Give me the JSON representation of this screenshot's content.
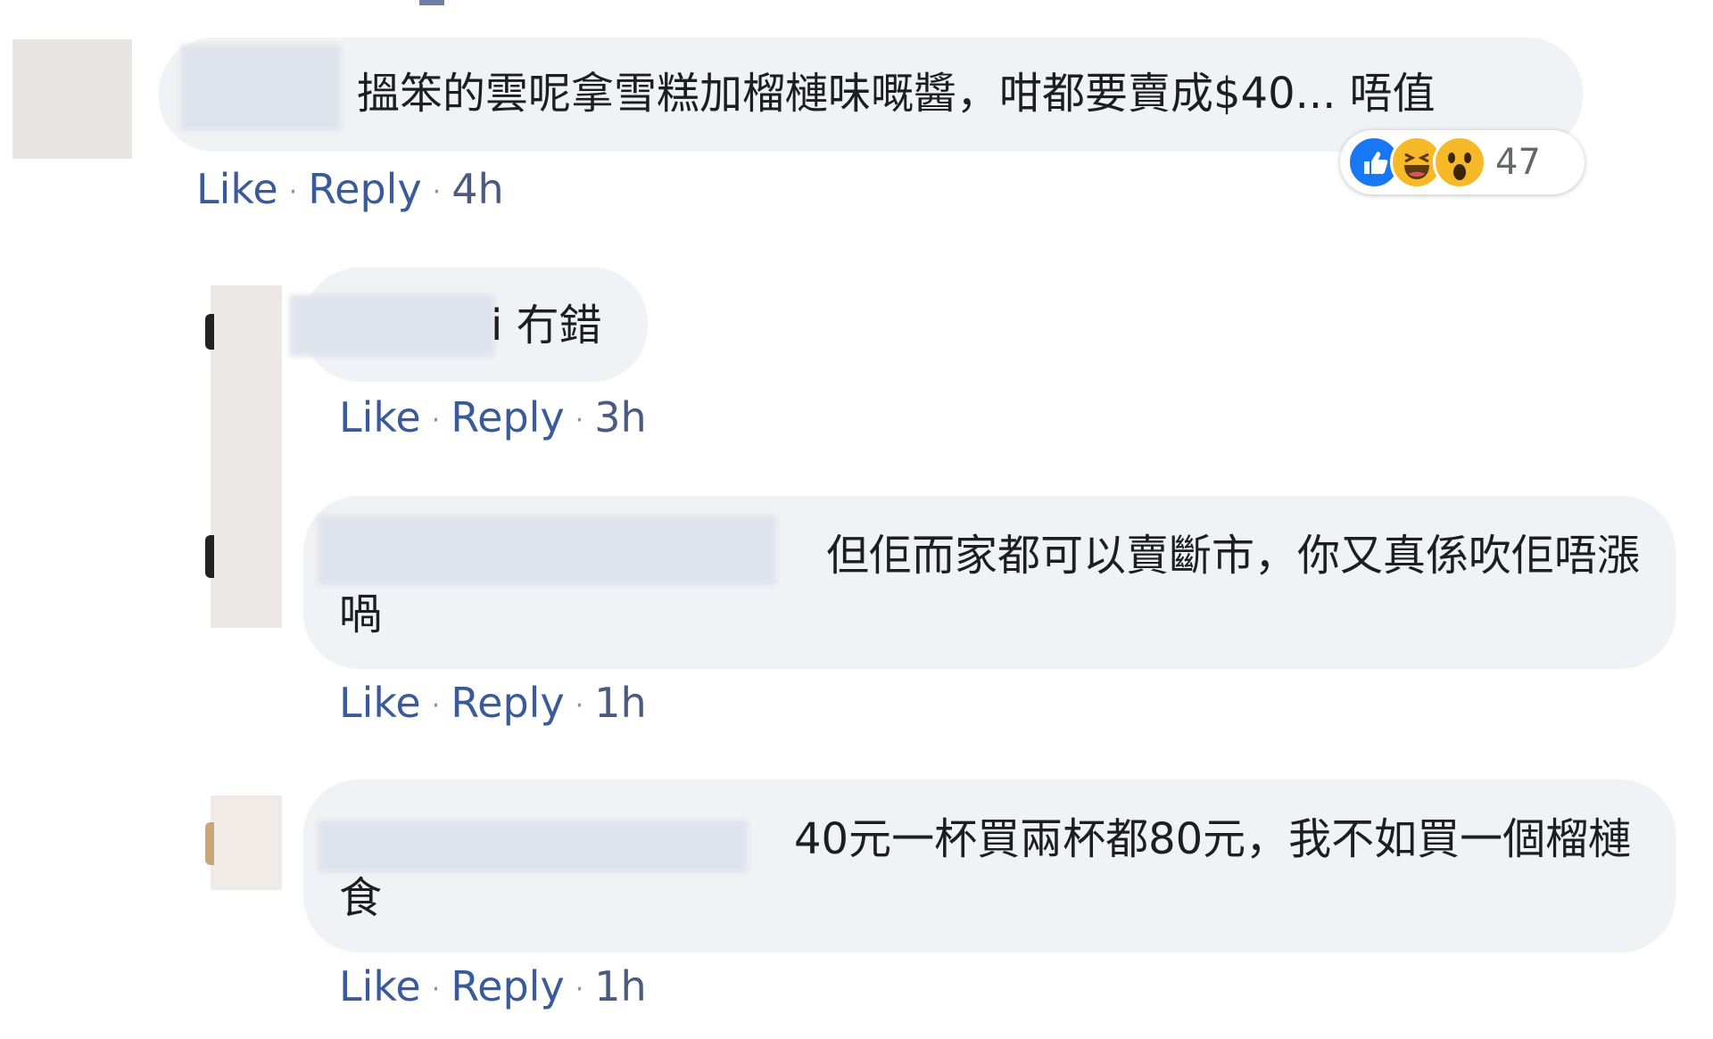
{
  "colors": {
    "bubble_bg": "#f0f2f5",
    "link_blue": "#3a5a9a",
    "like_blue": "#1877f2",
    "haha_yellow": "#f7b928"
  },
  "comments": [
    {
      "text": "搵笨的雲呢拿雪糕加榴槤味嘅醬，咁都要賣成$40... 唔值",
      "actions": {
        "like": "Like",
        "reply": "Reply",
        "time": "4h"
      },
      "reactions": {
        "icons": [
          "like-icon",
          "haha-icon",
          "wow-icon"
        ],
        "count": "47"
      },
      "replies": [
        {
          "text": "i 冇錯",
          "actions": {
            "like": "Like",
            "reply": "Reply",
            "time": "3h"
          }
        },
        {
          "text": "但佢而家都可以賣斷市，你又真係吹佢唔漲喎",
          "actions": {
            "like": "Like",
            "reply": "Reply",
            "time": "1h"
          }
        },
        {
          "text": "40元一杯買兩杯都80元，我不如買一個榴槤食",
          "actions": {
            "like": "Like",
            "reply": "Reply",
            "time": "1h"
          }
        }
      ]
    }
  ]
}
